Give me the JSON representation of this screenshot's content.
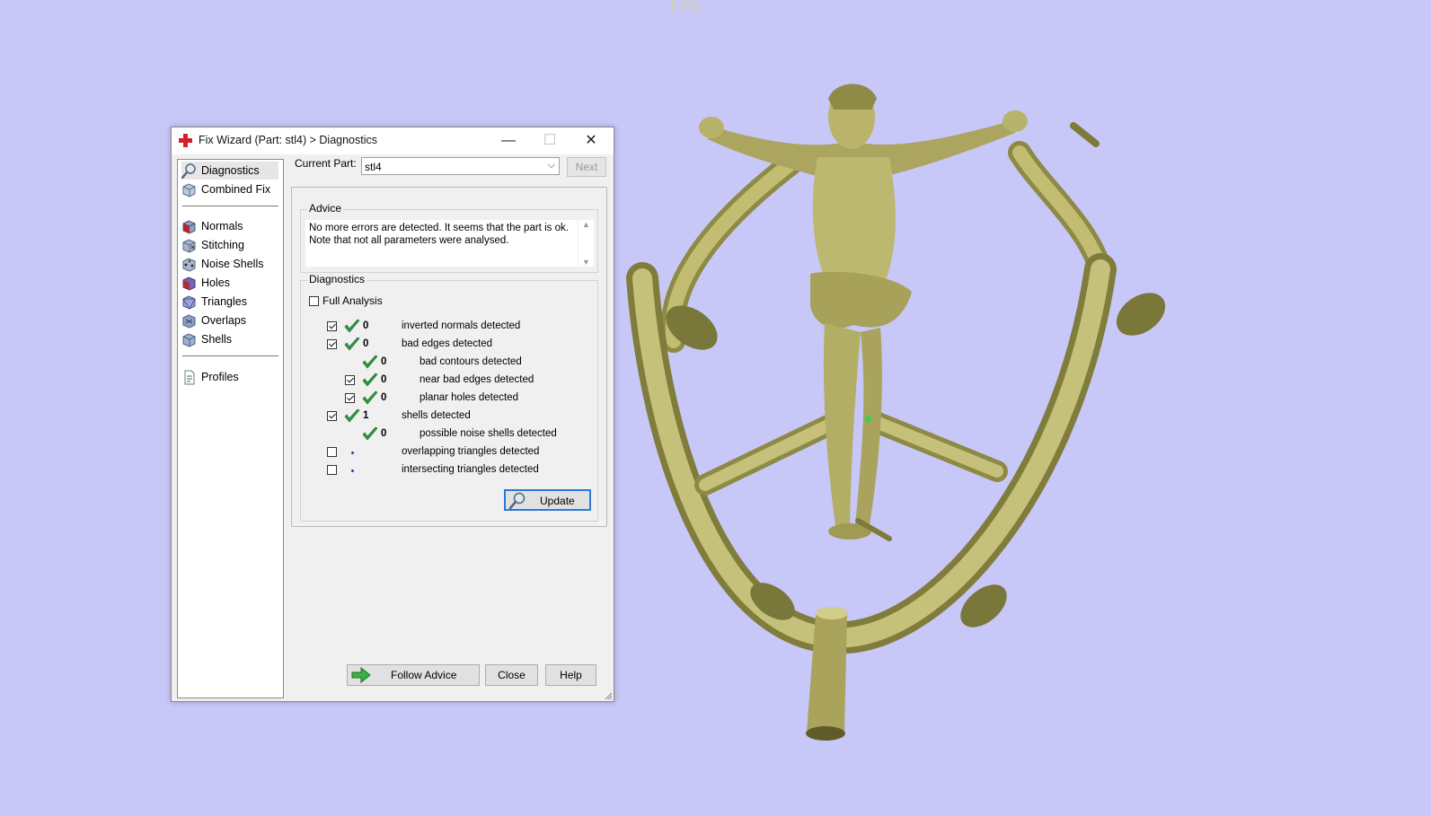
{
  "viewport": {
    "wcs_label": "WCS",
    "background": "#c8c8f8",
    "model_color": "#b9b46a"
  },
  "window": {
    "title": "Fix Wizard (Part: stl4) > Diagnostics",
    "icon": "red-cross-icon",
    "controls": {
      "minimize": "—",
      "maximize": "☐",
      "close": "✕"
    }
  },
  "sidebar": {
    "top_items": [
      {
        "label": "Diagnostics",
        "icon": "magnifier-icon",
        "selected": true
      },
      {
        "label": "Combined Fix",
        "icon": "cube-icon"
      }
    ],
    "fix_items": [
      {
        "label": "Normals",
        "icon": "normals-cube-icon"
      },
      {
        "label": "Stitching",
        "icon": "stitching-cube-icon"
      },
      {
        "label": "Noise Shells",
        "icon": "noise-shells-icon"
      },
      {
        "label": "Holes",
        "icon": "holes-cube-icon"
      },
      {
        "label": "Triangles",
        "icon": "triangles-cube-icon"
      },
      {
        "label": "Overlaps",
        "icon": "overlaps-cube-icon"
      },
      {
        "label": "Shells",
        "icon": "shells-cube-icon"
      }
    ],
    "bottom_items": [
      {
        "label": "Profiles",
        "icon": "document-icon"
      }
    ]
  },
  "current_part": {
    "label": "Current Part:",
    "value": "stl4",
    "next_label": "Next"
  },
  "advice": {
    "legend": "Advice",
    "line1": "No more errors are detected. It seems that the part is ok.",
    "line2": "Note that not all parameters were analysed."
  },
  "diagnostics": {
    "legend": "Diagnostics",
    "full_analysis_label": "Full Analysis",
    "full_analysis_checked": false,
    "rows": [
      {
        "label": "inverted normals detected",
        "count": "0",
        "checked": true,
        "status": "ok",
        "indent": 0
      },
      {
        "label": "bad edges detected",
        "count": "0",
        "checked": true,
        "status": "ok",
        "indent": 0
      },
      {
        "label": "bad contours detected",
        "count": "0",
        "checked": null,
        "status": "ok",
        "indent": 1
      },
      {
        "label": "near bad edges detected",
        "count": "0",
        "checked": true,
        "status": "ok",
        "indent": 1
      },
      {
        "label": "planar holes detected",
        "count": "0",
        "checked": true,
        "status": "ok",
        "indent": 1
      },
      {
        "label": "shells detected",
        "count": "1",
        "checked": true,
        "status": "ok",
        "indent": 0
      },
      {
        "label": "possible noise shells detected",
        "count": "0",
        "checked": null,
        "status": "ok",
        "indent": 1
      },
      {
        "label": "overlapping triangles detected",
        "count": "",
        "checked": false,
        "status": "not-run",
        "indent": 0
      },
      {
        "label": "intersecting triangles detected",
        "count": "",
        "checked": false,
        "status": "not-run",
        "indent": 0
      }
    ],
    "update_label": "Update"
  },
  "footer": {
    "follow_advice": "Follow Advice",
    "close": "Close",
    "help": "Help"
  }
}
